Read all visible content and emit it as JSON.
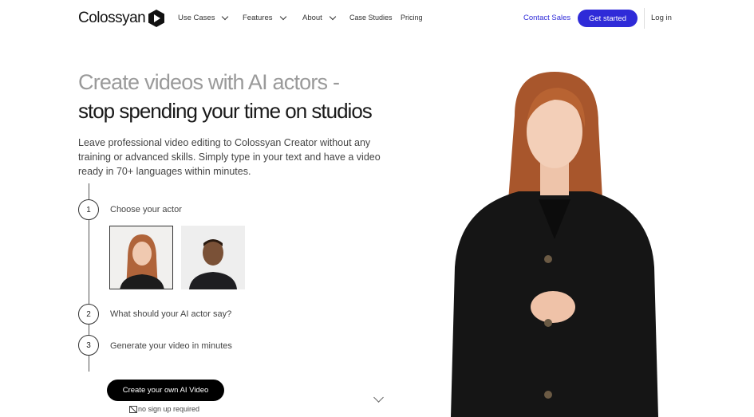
{
  "header": {
    "logo": "Colossyan",
    "nav": [
      {
        "label": "Use Cases",
        "dropdown": true
      },
      {
        "label": "Features",
        "dropdown": true
      },
      {
        "label": "About",
        "dropdown": true
      },
      {
        "label": "Case Studies"
      },
      {
        "label": "Pricing"
      }
    ],
    "contact_sales": "Contact Sales",
    "get_started": "Get started",
    "login": "Log in",
    "accent": "#2f2bd8"
  },
  "hero": {
    "title_line1": "Create videos with AI actors -",
    "title_line2": "stop spending your time on studios",
    "description": "Leave professional video editing to Colossyan Creator without any training or advanced skills. Simply type in your text and have a video ready in 70+ languages within minutes.",
    "steps": [
      {
        "num": "1",
        "label": "Choose your actor"
      },
      {
        "num": "2",
        "label": "What should your AI actor say?"
      },
      {
        "num": "3",
        "label": "Generate your video in minutes"
      }
    ],
    "actors": [
      "female-actor",
      "male-actor"
    ],
    "cta": "Create your own AI Video",
    "note": "no sign up required"
  }
}
